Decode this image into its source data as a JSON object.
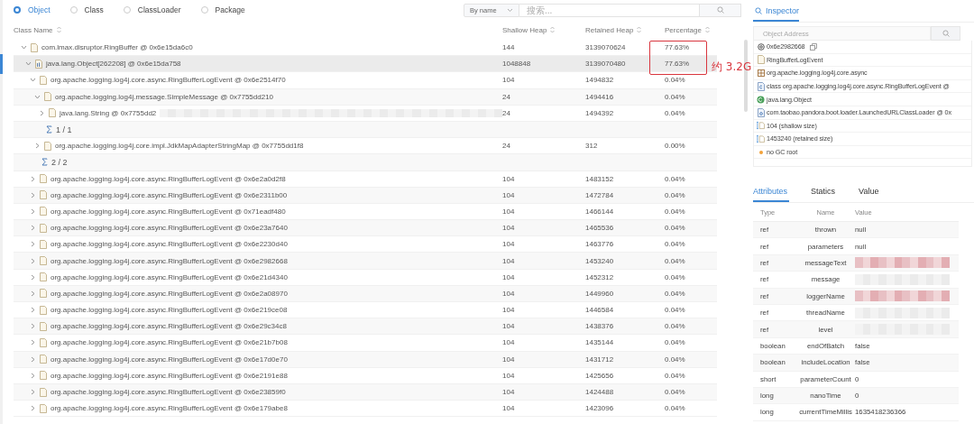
{
  "modes": [
    {
      "label": "Object",
      "selected": true
    },
    {
      "label": "Class",
      "selected": false
    },
    {
      "label": "ClassLoader",
      "selected": false
    },
    {
      "label": "Package",
      "selected": false
    }
  ],
  "search": {
    "sort": "By name",
    "placeholder": "搜索..."
  },
  "table": {
    "columns": [
      "Class Name",
      "Shallow Heap",
      "Retained Heap",
      "Percentage"
    ],
    "rows": [
      {
        "kind": "object",
        "name": "com.lmax.disruptor.RingBuffer @ 0x6e15da6c0",
        "shallow": "144",
        "retained": "3139070624",
        "percentage": "77.63%",
        "expanded": true,
        "selected": false,
        "children": [
          {
            "kind": "array",
            "name": "java.lang.Object[262208] @ 0x6e15da758",
            "shallow": "1048848",
            "retained": "3139070480",
            "percentage": "77.63%",
            "expanded": true,
            "selected": true,
            "children": [
              {
                "kind": "object",
                "name": "org.apache.logging.log4j.core.async.RingBufferLogEvent @ 0x6e2514f70",
                "shallow": "104",
                "retained": "1494832",
                "percentage": "0.04%",
                "expanded": true,
                "selected": false,
                "children": [
                  {
                    "kind": "object",
                    "name": "org.apache.logging.log4j.message.SimpleMessage @ 0x7755dd210",
                    "shallow": "24",
                    "retained": "1494416",
                    "percentage": "0.04%",
                    "expanded": true,
                    "selected": false,
                    "children": [
                      {
                        "kind": "object",
                        "name": "java.lang.String @ 0x7755dd2",
                        "blurred": true,
                        "shallow": "24",
                        "retained": "1494392",
                        "percentage": "0.04%",
                        "expanded": false,
                        "selected": false
                      },
                      {
                        "kind": "summary",
                        "name": "1 / 1"
                      }
                    ]
                  },
                  {
                    "kind": "object",
                    "name": "org.apache.logging.log4j.core.impl.JdkMapAdapterStringMap @ 0x7755dd1f8",
                    "shallow": "24",
                    "retained": "312",
                    "percentage": "0.00%",
                    "expanded": false,
                    "selected": false
                  },
                  {
                    "kind": "summary",
                    "name": "2 / 2"
                  }
                ]
              },
              {
                "kind": "object",
                "name": "org.apache.logging.log4j.core.async.RingBufferLogEvent @ 0x6e2a0d2f8",
                "shallow": "104",
                "retained": "1483152",
                "percentage": "0.04%",
                "expanded": false,
                "selected": false
              },
              {
                "kind": "object",
                "name": "org.apache.logging.log4j.core.async.RingBufferLogEvent @ 0x6e2311b00",
                "shallow": "104",
                "retained": "1472784",
                "percentage": "0.04%",
                "expanded": false,
                "selected": false
              },
              {
                "kind": "object",
                "name": "org.apache.logging.log4j.core.async.RingBufferLogEvent @ 0x71eadf480",
                "shallow": "104",
                "retained": "1466144",
                "percentage": "0.04%",
                "expanded": false,
                "selected": false
              },
              {
                "kind": "object",
                "name": "org.apache.logging.log4j.core.async.RingBufferLogEvent @ 0x6e23a7640",
                "shallow": "104",
                "retained": "1465536",
                "percentage": "0.04%",
                "expanded": false,
                "selected": false
              },
              {
                "kind": "object",
                "name": "org.apache.logging.log4j.core.async.RingBufferLogEvent @ 0x6e2230d40",
                "shallow": "104",
                "retained": "1463776",
                "percentage": "0.04%",
                "expanded": false,
                "selected": false
              },
              {
                "kind": "object",
                "name": "org.apache.logging.log4j.core.async.RingBufferLogEvent @ 0x6e2982668",
                "shallow": "104",
                "retained": "1453240",
                "percentage": "0.04%",
                "expanded": false,
                "selected": false
              },
              {
                "kind": "object",
                "name": "org.apache.logging.log4j.core.async.RingBufferLogEvent @ 0x6e21d4340",
                "shallow": "104",
                "retained": "1452312",
                "percentage": "0.04%",
                "expanded": false,
                "selected": false
              },
              {
                "kind": "object",
                "name": "org.apache.logging.log4j.core.async.RingBufferLogEvent @ 0x6e2a08970",
                "shallow": "104",
                "retained": "1449960",
                "percentage": "0.04%",
                "expanded": false,
                "selected": false
              },
              {
                "kind": "object",
                "name": "org.apache.logging.log4j.core.async.RingBufferLogEvent @ 0x6e219ce08",
                "shallow": "104",
                "retained": "1446584",
                "percentage": "0.04%",
                "expanded": false,
                "selected": false
              },
              {
                "kind": "object",
                "name": "org.apache.logging.log4j.core.async.RingBufferLogEvent @ 0x6e29c34c8",
                "shallow": "104",
                "retained": "1438376",
                "percentage": "0.04%",
                "expanded": false,
                "selected": false
              },
              {
                "kind": "object",
                "name": "org.apache.logging.log4j.core.async.RingBufferLogEvent @ 0x6e21b7b08",
                "shallow": "104",
                "retained": "1435144",
                "percentage": "0.04%",
                "expanded": false,
                "selected": false
              },
              {
                "kind": "object",
                "name": "org.apache.logging.log4j.core.async.RingBufferLogEvent @ 0x6e17d0e70",
                "shallow": "104",
                "retained": "1431712",
                "percentage": "0.04%",
                "expanded": false,
                "selected": false
              },
              {
                "kind": "object",
                "name": "org.apache.logging.log4j.core.async.RingBufferLogEvent @ 0x6e2191e88",
                "shallow": "104",
                "retained": "1425656",
                "percentage": "0.04%",
                "expanded": false,
                "selected": false
              },
              {
                "kind": "object",
                "name": "org.apache.logging.log4j.core.async.RingBufferLogEvent @ 0x6e23859f0",
                "shallow": "104",
                "retained": "1424488",
                "percentage": "0.04%",
                "expanded": false,
                "selected": false
              },
              {
                "kind": "object",
                "name": "org.apache.logging.log4j.core.async.RingBufferLogEvent @ 0x6e179abe8",
                "shallow": "104",
                "retained": "1423096",
                "percentage": "0.04%",
                "expanded": false,
                "selected": false
              }
            ]
          }
        ]
      }
    ]
  },
  "annotation": {
    "text": "约 3.2G",
    "color": "#d9363e"
  },
  "inspector": {
    "tab": "Inspector",
    "placeholder": "Object Address",
    "items": [
      {
        "kind": "address",
        "text": "0x6e2982668"
      },
      {
        "kind": "file",
        "text": "RingBufferLogEvent"
      },
      {
        "kind": "package",
        "text": "org.apache.logging.log4j.core.async"
      },
      {
        "kind": "class",
        "text": "class org.apache.logging.log4j.core.async.RingBufferLogEvent @"
      },
      {
        "kind": "super",
        "text": "java.lang.Object"
      },
      {
        "kind": "loader",
        "text": "com.taobao.pandora.boot.loader.LaunchedURLClassLoader @ 0x"
      },
      {
        "kind": "size",
        "text": "104 (shallow size)"
      },
      {
        "kind": "size",
        "text": "1453240 (retained size)"
      },
      {
        "kind": "gcroot",
        "text": "no GC root"
      }
    ],
    "tabs": [
      {
        "label": "Attributes",
        "selected": true
      },
      {
        "label": "Statics",
        "selected": false
      },
      {
        "label": "Value",
        "selected": false
      }
    ],
    "columns": [
      "Type",
      "Name",
      "Value"
    ],
    "attributes": [
      {
        "type": "ref",
        "name": "thrown",
        "kind": "text",
        "value": "null"
      },
      {
        "type": "ref",
        "name": "parameters",
        "kind": "text",
        "value": "null"
      },
      {
        "type": "ref",
        "name": "messageText",
        "kind": "blurred-red"
      },
      {
        "type": "ref",
        "name": "message",
        "kind": "blurred"
      },
      {
        "type": "ref",
        "name": "loggerName",
        "kind": "blurred-red"
      },
      {
        "type": "ref",
        "name": "threadName",
        "kind": "blurred"
      },
      {
        "type": "ref",
        "name": "level",
        "kind": "blurred"
      },
      {
        "type": "boolean",
        "name": "endOfBatch",
        "kind": "text",
        "value": "false"
      },
      {
        "type": "boolean",
        "name": "includeLocation",
        "kind": "text",
        "value": "false"
      },
      {
        "type": "short",
        "name": "parameterCount",
        "kind": "text",
        "value": "0"
      },
      {
        "type": "long",
        "name": "nanoTime",
        "kind": "text",
        "value": "0"
      },
      {
        "type": "long",
        "name": "currentTimeMillis",
        "kind": "text",
        "value": "1635418236366"
      }
    ]
  }
}
